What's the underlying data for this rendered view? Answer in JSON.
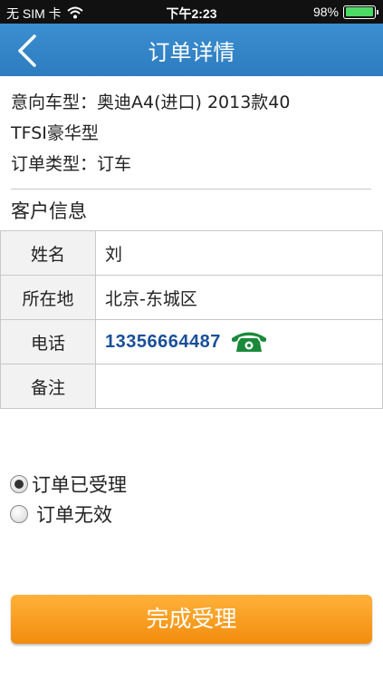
{
  "status_bar": {
    "carrier": "无 SIM 卡",
    "time": "下午2:23",
    "battery": "98%",
    "battery_level": 0.98
  },
  "nav": {
    "title": "订单详情",
    "back_icon": "chevron-left-icon"
  },
  "order": {
    "model_line1": "意向车型：奥迪A4(进口) 2013款40",
    "model_line2": "TFSI豪华型",
    "type": "订单类型：订车"
  },
  "customer": {
    "section_title": "客户信息",
    "rows": [
      {
        "label": "姓名",
        "value": "刘"
      },
      {
        "label": "所在地",
        "value": "北京-东城区"
      },
      {
        "label": "电话",
        "value": "13356664487"
      },
      {
        "label": "备注",
        "value": ""
      }
    ],
    "phone_icon": "phone-icon",
    "phone_icon_color": "#1a8a3a"
  },
  "status_options": [
    {
      "label": "订单已受理",
      "checked": true
    },
    {
      "label": "订单无效",
      "checked": false
    }
  ],
  "submit_label": "完成受理",
  "colors": {
    "nav": "#3388cc",
    "button": "#f59a1e",
    "phone_text": "#1a4f99"
  }
}
